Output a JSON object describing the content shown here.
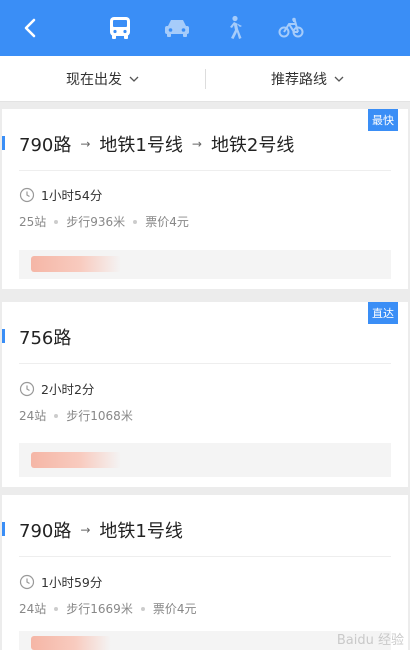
{
  "header": {
    "modes": [
      {
        "name": "bus",
        "icon": "bus-icon",
        "active": true
      },
      {
        "name": "car",
        "icon": "car-icon",
        "active": false
      },
      {
        "name": "walk",
        "icon": "walk-icon",
        "active": false
      },
      {
        "name": "bike",
        "icon": "bike-icon",
        "active": false
      }
    ],
    "accent": "#3a8ef6"
  },
  "filters": {
    "departure": "现在出发",
    "sort": "推荐路线"
  },
  "routes": [
    {
      "tag": "最快",
      "segments": [
        "790路",
        "地铁1号线",
        "地铁2号线"
      ],
      "duration": "1小时54分",
      "stops": "25站",
      "walk": "步行936米",
      "fare": "票价4元"
    },
    {
      "tag": "直达",
      "segments": [
        "756路"
      ],
      "duration": "2小时2分",
      "stops": "24站",
      "walk": "步行1068米",
      "fare": ""
    },
    {
      "tag": "",
      "segments": [
        "790路",
        "地铁1号线"
      ],
      "duration": "1小时59分",
      "stops": "24站",
      "walk": "步行1669米",
      "fare": "票价4元"
    }
  ],
  "watermark": "Baidu 经验"
}
